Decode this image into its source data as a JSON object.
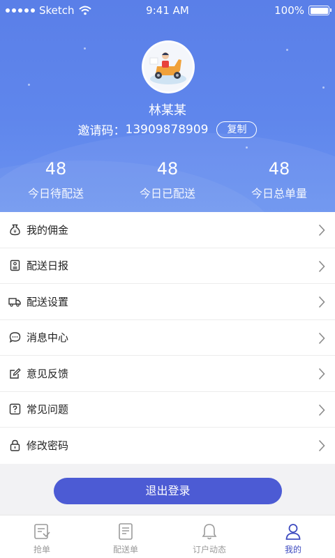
{
  "status_bar": {
    "carrier": "Sketch",
    "time": "9:41 AM",
    "battery": "100%"
  },
  "profile": {
    "name": "林某某",
    "invite_label": "邀请码：",
    "invite_code": "13909878909",
    "copy_label": "复制"
  },
  "stats": [
    {
      "value": "48",
      "label": "今日待配送"
    },
    {
      "value": "48",
      "label": "今日已配送"
    },
    {
      "value": "48",
      "label": "今日总单量"
    }
  ],
  "menu": [
    {
      "label": "我的佣金",
      "icon": "money-bag-icon"
    },
    {
      "label": "配送日报",
      "icon": "report-icon"
    },
    {
      "label": "配送设置",
      "icon": "delivery-truck-icon"
    },
    {
      "label": "消息中心",
      "icon": "message-icon"
    },
    {
      "label": "意见反馈",
      "icon": "edit-icon"
    },
    {
      "label": "常见问题",
      "icon": "question-icon"
    },
    {
      "label": "修改密码",
      "icon": "lock-icon"
    }
  ],
  "logout_label": "退出登录",
  "tabs": [
    {
      "label": "抢单",
      "icon": "grab-order-icon",
      "active": false
    },
    {
      "label": "配送单",
      "icon": "delivery-list-icon",
      "active": false
    },
    {
      "label": "订户动态",
      "icon": "bell-icon",
      "active": false
    },
    {
      "label": "我的",
      "icon": "user-icon",
      "active": true
    }
  ],
  "colors": {
    "header": "#5f86ec",
    "accent": "#4c5bd4",
    "tab_active": "#3e4bc0"
  }
}
